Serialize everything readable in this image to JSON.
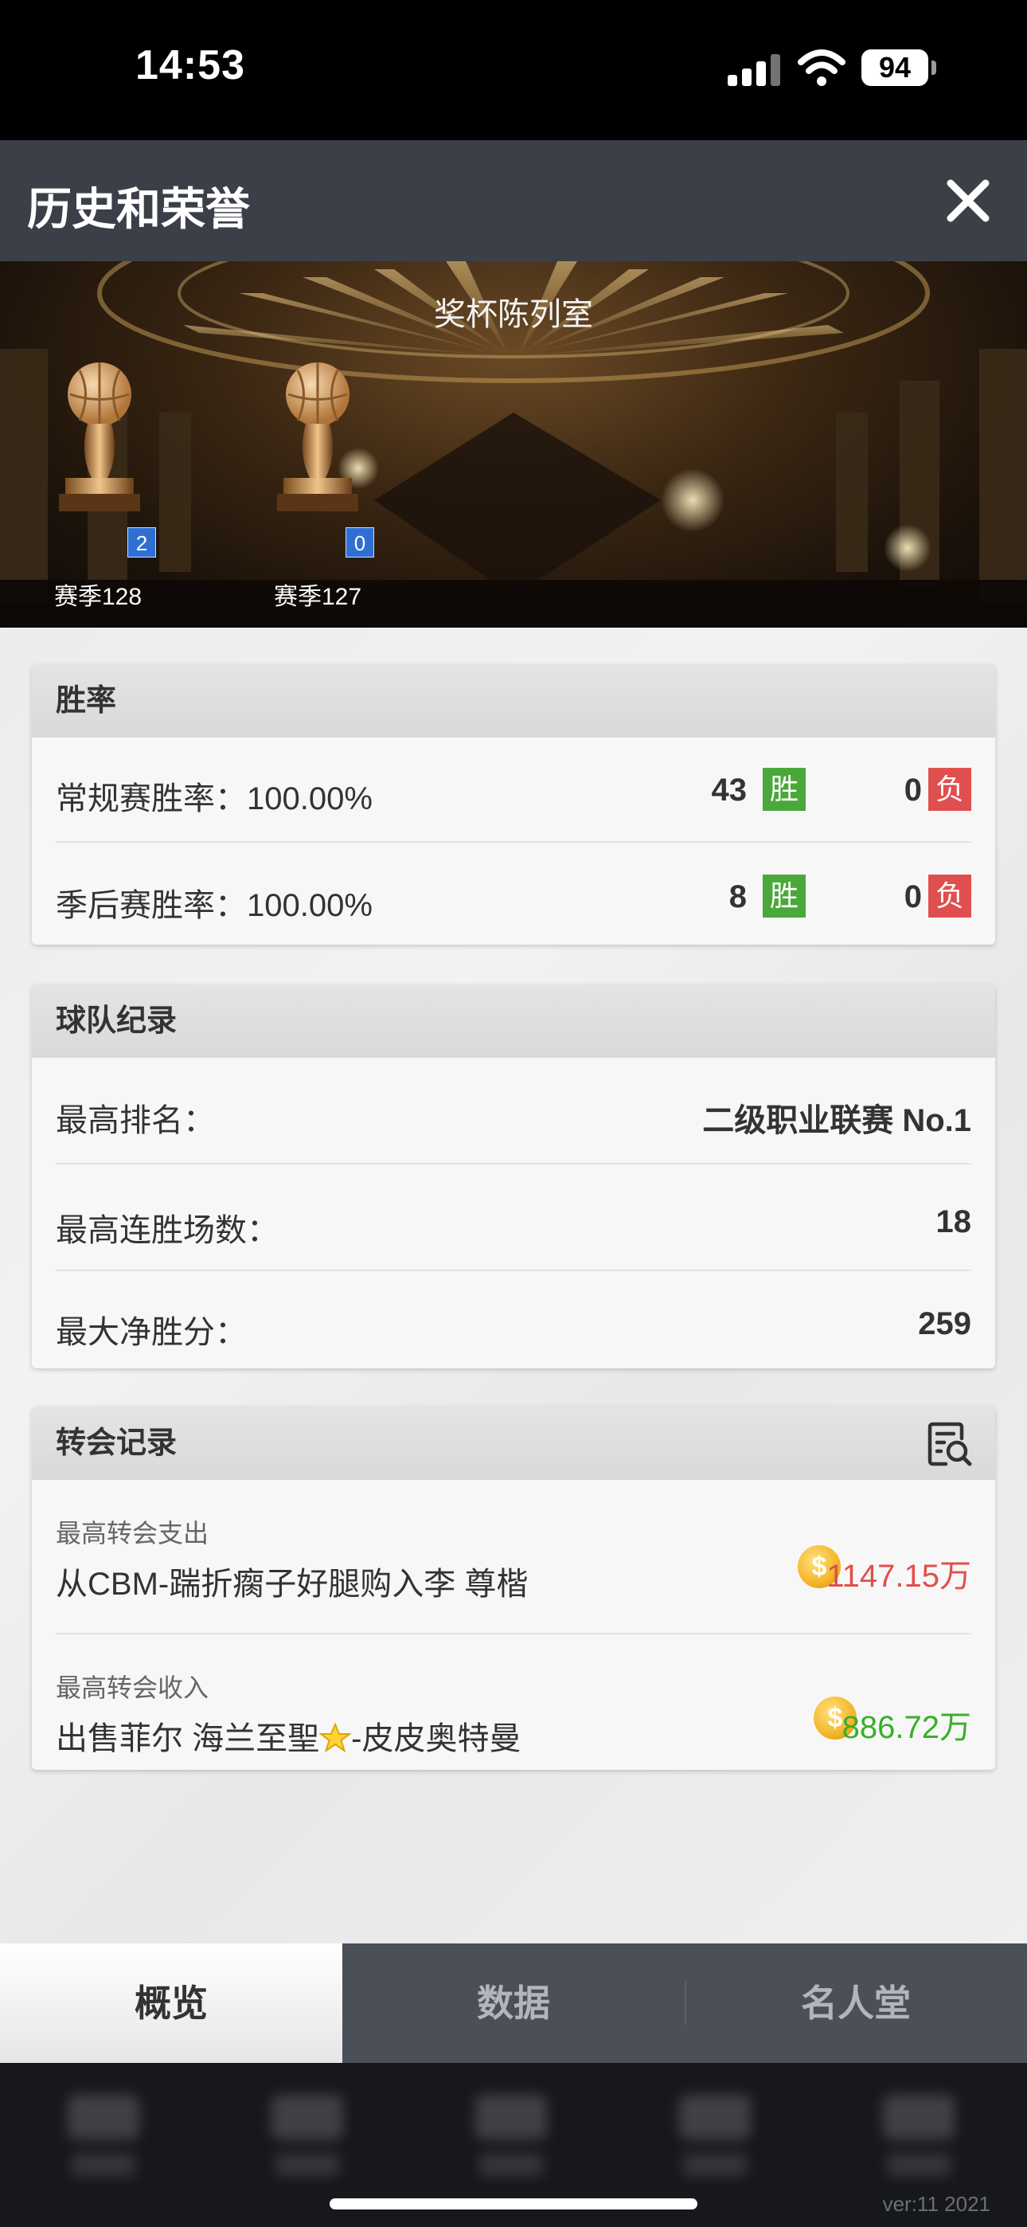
{
  "status": {
    "time": "14:53",
    "battery": "94"
  },
  "header": {
    "title": "历史和荣誉"
  },
  "trophy_room": {
    "title": "奖杯陈列室",
    "trophies": [
      {
        "label": "赛季128",
        "count": "2"
      },
      {
        "label": "赛季127",
        "count": "0"
      }
    ]
  },
  "win_rate": {
    "title": "胜率",
    "regular": {
      "label": "常规赛胜率：100.00%",
      "wins": "43",
      "win_tag": "胜",
      "losses": "0",
      "loss_tag": "负"
    },
    "playoff": {
      "label": "季后赛胜率：100.00%",
      "wins": "8",
      "win_tag": "胜",
      "losses": "0",
      "loss_tag": "负"
    }
  },
  "team_record": {
    "title": "球队纪录",
    "rows": [
      {
        "label": "最高排名：",
        "value": "二级职业联赛 No.1"
      },
      {
        "label": "最高连胜场数：",
        "value": "18"
      },
      {
        "label": "最大净胜分：",
        "value": "259"
      }
    ]
  },
  "transfer_record": {
    "title": "转会记录",
    "expense": {
      "label": "最高转会支出",
      "text": "从CBM-踹折瘸子好腿购入李 尊楷",
      "amount": "1147.15万"
    },
    "income": {
      "label": "最高转会收入",
      "text_before": "出售菲尔 海兰至聖",
      "text_after": "-皮皮奥特曼",
      "amount": "886.72万"
    }
  },
  "tabs": [
    {
      "label": "概览",
      "active": true
    },
    {
      "label": "数据",
      "active": false
    },
    {
      "label": "名人堂",
      "active": false
    }
  ],
  "footer": {
    "version": "ver:11  2021"
  },
  "colors": {
    "win": "#4aa83a",
    "loss": "#e04f4f",
    "expense": "#e0504a",
    "income": "#3aae2a",
    "badge": "#2f6fd1"
  }
}
